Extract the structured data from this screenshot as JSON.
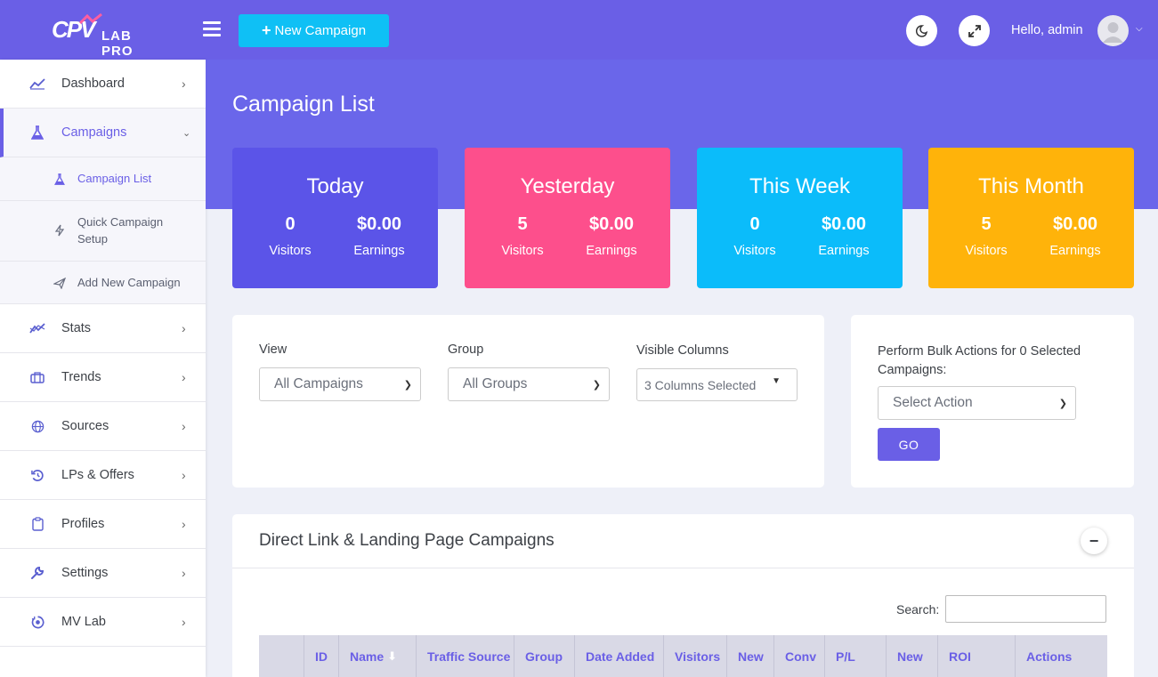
{
  "header": {
    "logo_text_main": "CPV",
    "logo_text_sub": "LAB PRO",
    "new_campaign_label": "New Campaign",
    "greeting": "Hello, admin",
    "icons": [
      "menu-icon",
      "moon-icon",
      "expand-icon",
      "user-icon",
      "chevron-down-icon"
    ]
  },
  "sidebar": {
    "items": [
      {
        "label": "Dashboard",
        "icon": "chart-line-icon"
      },
      {
        "label": "Campaigns",
        "icon": "flask-icon"
      },
      {
        "label": "Stats",
        "icon": "stats-icon"
      },
      {
        "label": "Trends",
        "icon": "briefcase-icon"
      },
      {
        "label": "Sources",
        "icon": "globe-icon"
      },
      {
        "label": "LPs & Offers",
        "icon": "history-icon"
      },
      {
        "label": "Profiles",
        "icon": "clipboard-icon"
      },
      {
        "label": "Settings",
        "icon": "wrench-icon"
      },
      {
        "label": "MV Lab",
        "icon": "target-icon"
      }
    ],
    "sub_items": [
      {
        "label": "Campaign List",
        "icon": "flask-icon"
      },
      {
        "label": "Quick Campaign Setup",
        "icon": "bolt-icon"
      },
      {
        "label": "Add New Campaign",
        "icon": "paper-plane-icon"
      }
    ]
  },
  "main": {
    "page_title": "Campaign List",
    "stats": [
      {
        "title": "Today",
        "visitors": "0",
        "earnings": "$0.00",
        "visitors_label": "Visitors",
        "earnings_label": "Earnings",
        "color": "#5b54e8"
      },
      {
        "title": "Yesterday",
        "visitors": "5",
        "earnings": "$0.00",
        "visitors_label": "Visitors",
        "earnings_label": "Earnings",
        "color": "#fd4f8c"
      },
      {
        "title": "This Week",
        "visitors": "0",
        "earnings": "$0.00",
        "visitors_label": "Visitors",
        "earnings_label": "Earnings",
        "color": "#0bbcfa"
      },
      {
        "title": "This Month",
        "visitors": "5",
        "earnings": "$0.00",
        "visitors_label": "Visitors",
        "earnings_label": "Earnings",
        "color": "#ffb30a"
      }
    ],
    "filters": {
      "view_label": "View",
      "view_value": "All Campaigns",
      "group_label": "Group",
      "group_value": "All Groups",
      "columns_label": "Visible Columns",
      "columns_value": "3 Columns Selected"
    },
    "bulk": {
      "label": "Perform Bulk Actions for 0 Selected Campaigns:",
      "select_value": "Select Action",
      "go_label": "GO"
    },
    "section": {
      "title": "Direct Link & Landing Page Campaigns",
      "collapse_label": "−",
      "search_label": "Search:"
    },
    "table": {
      "columns": [
        "",
        "ID",
        "Name",
        "Traffic Source",
        "Group",
        "Date Added",
        "Visitors",
        "New",
        "Conv",
        "P/L",
        "New",
        "ROI",
        "Actions"
      ]
    }
  }
}
